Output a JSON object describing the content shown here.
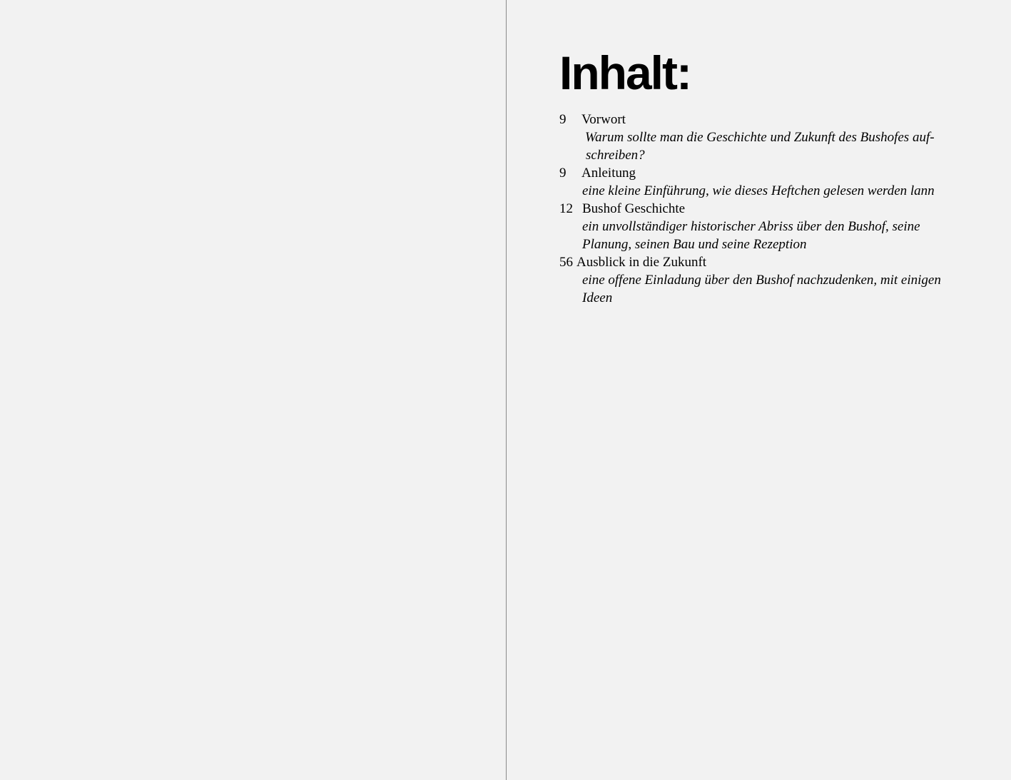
{
  "heading": "Inhalt:",
  "entries": [
    {
      "page": "9",
      "title": "Vorwort",
      "description": "Warum sollte man die Geschichte und Zukunft des Bushofes auf-schreiben?"
    },
    {
      "page": "9",
      "title": "Anleitung",
      "description": "eine kleine Einführung, wie dieses Heftchen gelesen werden lann"
    },
    {
      "page": "12",
      "title": "Bushof Geschichte",
      "description": "ein unvollständiger historischer Abriss über den Bushof, seine Planung, seinen Bau und seine Rezeption"
    },
    {
      "page": "56",
      "title": "Ausblick in die Zukunft",
      "description": "eine offene Einladung über den Bushof nachzudenken, mit einigen Ideen"
    }
  ],
  "colors": {
    "page_background": "#f2f2f2",
    "gutter_line": "#8a8a8a",
    "text": "#000000"
  }
}
